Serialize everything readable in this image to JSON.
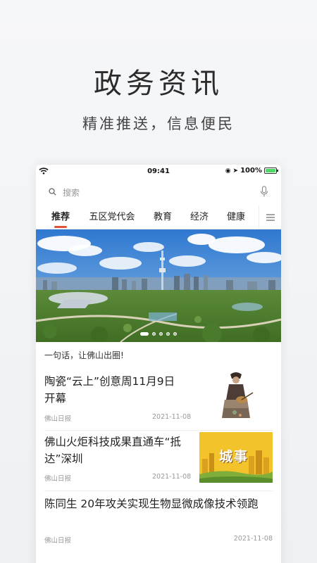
{
  "promo": {
    "title": "政务资讯",
    "subtitle": "精准推送，信息便民"
  },
  "status_bar": {
    "time": "09:41",
    "battery": "100%"
  },
  "search": {
    "placeholder": "搜索"
  },
  "tabs": [
    {
      "label": "推荐",
      "active": true
    },
    {
      "label": "五区党代会",
      "active": false
    },
    {
      "label": "教育",
      "active": false
    },
    {
      "label": "经济",
      "active": false
    },
    {
      "label": "健康",
      "active": false
    }
  ],
  "banner": {
    "caption": "一句话，让佛山出圈!",
    "slides_count": 5,
    "active_slide": 0
  },
  "news": [
    {
      "title": "陶瓷“云上”创意周11月9日开幕",
      "source": "佛山日报",
      "date": "2021-11-08",
      "thumbnail": "ceramic-figure"
    },
    {
      "title": "佛山火炬科技成果直通车“抵达”深圳",
      "source": "佛山日报",
      "date": "2021-11-08",
      "thumbnail": "city-poster",
      "thumb_text": "城事"
    },
    {
      "title": "陈同生 20年攻关实现生物显微成像技术领跑",
      "source": "佛山日报",
      "date": "2021-11-08"
    }
  ],
  "colors": {
    "accent": "#e2533f",
    "thumbnail_yellow": "#f2c32a",
    "sky": "#3f86d6"
  }
}
